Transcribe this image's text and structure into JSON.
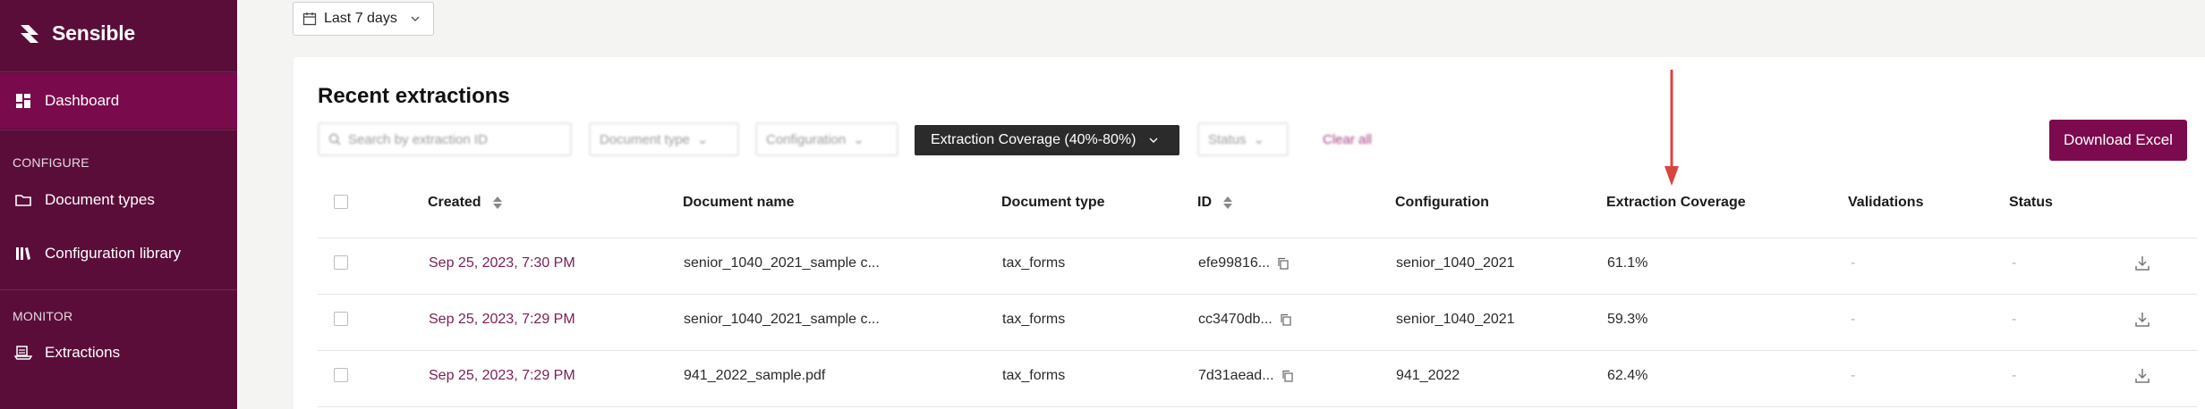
{
  "app": {
    "name": "Sensible"
  },
  "sidebar": {
    "dashboard_label": "Dashboard",
    "configure_heading": "CONFIGURE",
    "document_types_label": "Document types",
    "configuration_library_label": "Configuration library",
    "monitor_heading": "MONITOR",
    "extractions_label": "Extractions"
  },
  "toolbar": {
    "date_range": "Last 7 days"
  },
  "main": {
    "title": "Recent extractions",
    "filters": {
      "search_placeholder": "Search by extraction ID",
      "document_type": "Document type",
      "configuration": "Configuration",
      "coverage_active": "Extraction Coverage (40%-80%)",
      "status": "Status",
      "clear_all": "Clear all"
    },
    "download_label": "Download Excel",
    "columns": [
      "Created",
      "Document name",
      "Document type",
      "ID",
      "Configuration",
      "Extraction Coverage",
      "Validations",
      "Status"
    ],
    "rows": [
      {
        "created": "Sep 25, 2023, 7:30 PM",
        "document_name": "senior_1040_2021_sample c...",
        "document_type": "tax_forms",
        "id": "efe99816...",
        "configuration": "senior_1040_2021",
        "coverage": "61.1%",
        "validations": "-",
        "status": "-"
      },
      {
        "created": "Sep 25, 2023, 7:29 PM",
        "document_name": "senior_1040_2021_sample c...",
        "document_type": "tax_forms",
        "id": "cc3470db...",
        "configuration": "senior_1040_2021",
        "coverage": "59.3%",
        "validations": "-",
        "status": "-"
      },
      {
        "created": "Sep 25, 2023, 7:29 PM",
        "document_name": "941_2022_sample.pdf",
        "document_type": "tax_forms",
        "id": "7d31aead...",
        "configuration": "941_2022",
        "coverage": "62.4%",
        "validations": "-",
        "status": "-"
      }
    ]
  },
  "colors": {
    "sidebar": "#5b0d3a",
    "sidebar_active": "#790a4c",
    "brand": "#7c0a4f",
    "annotation": "#d9443f"
  }
}
